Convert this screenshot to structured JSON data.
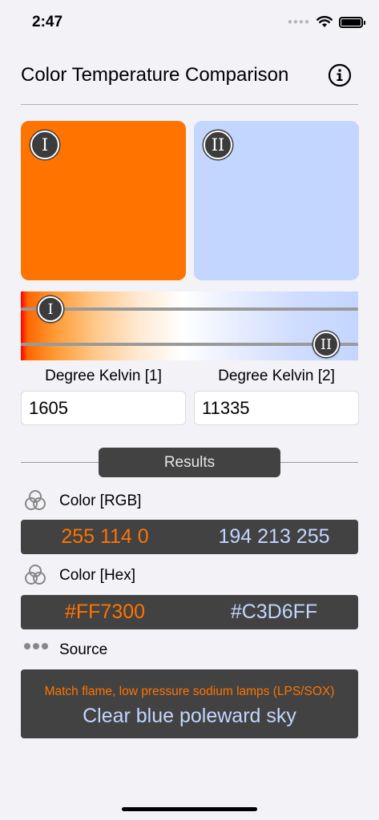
{
  "status_bar": {
    "time": "2:47"
  },
  "header": {
    "title": "Color Temperature Comparison"
  },
  "swatches": [
    {
      "badge": "I",
      "color": "#ff7300"
    },
    {
      "badge": "II",
      "color": "#c3d6ff"
    }
  ],
  "slider": {
    "thumb1_label": "I",
    "thumb2_label": "II"
  },
  "inputs": [
    {
      "label": "Degree Kelvin [1]",
      "value": "1605"
    },
    {
      "label": "Degree Kelvin [2]",
      "value": "11335"
    }
  ],
  "results": {
    "button_label": "Results",
    "rgb": {
      "label": "Color [RGB]",
      "left": "255 114 0",
      "right": "194 213 255"
    },
    "hex": {
      "label": "Color [Hex]",
      "left": "#FF7300",
      "right": "#C3D6FF"
    },
    "source": {
      "label": "Source",
      "left": "Match flame, low pressure sodium lamps (LPS/SOX)",
      "right": "Clear blue poleward sky"
    }
  },
  "colors": {
    "accent_warm": "#ff7300",
    "accent_cool": "#c3d6ff",
    "panel": "#424242"
  }
}
